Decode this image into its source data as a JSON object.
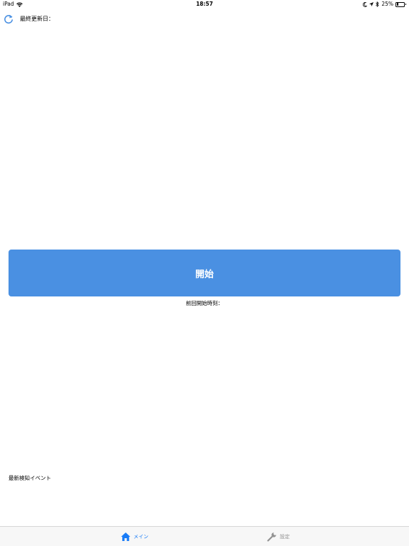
{
  "status_bar": {
    "device": "iPad",
    "time": "18:57",
    "battery": "25%",
    "battery_level": 0.25
  },
  "header": {
    "last_updated_label": "最終更新日："
  },
  "main": {
    "start_button_label": "開始",
    "prev_start_label": "前回開始時刻：",
    "latest_event_label": "最新検知イベント"
  },
  "tab_bar": {
    "tabs": [
      {
        "label": "メイン",
        "icon": "home-icon",
        "selected": true
      },
      {
        "label": "設定",
        "icon": "wrench-icon",
        "selected": false
      }
    ]
  },
  "colors": {
    "accent": "#4a90e2",
    "tab_selected": "#1a7cf7",
    "tab_unselected": "#929292"
  }
}
